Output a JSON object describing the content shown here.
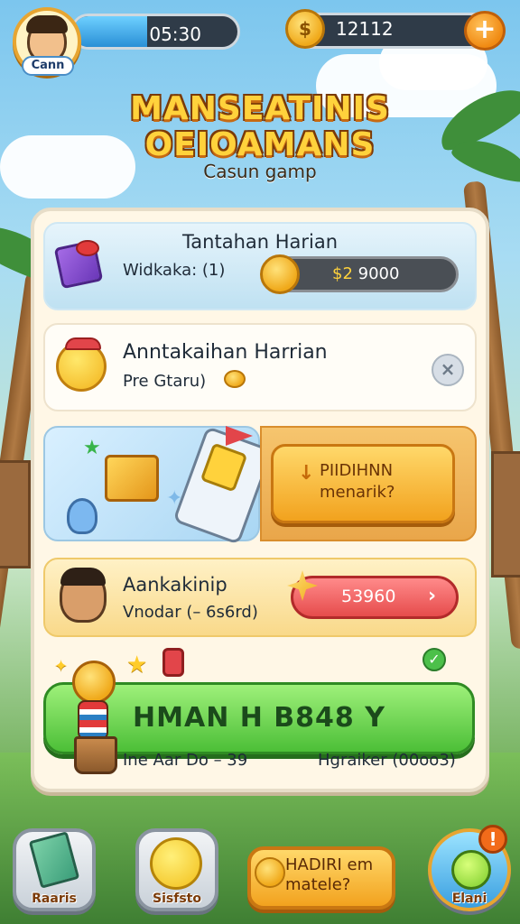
{
  "hud": {
    "player_name": "Cann",
    "timer": "05:30",
    "timer_progress": 0.45,
    "coins": "12112",
    "add_button": "+"
  },
  "title": {
    "line1": "MANSEATINIS",
    "line2": "OEIOAMANS",
    "subtitle": "Casun gamp"
  },
  "daily_card": {
    "heading": "Tantahan Harian",
    "label": "Widkaka: (1)",
    "currency": "$2",
    "amount": "9000"
  },
  "announcement_card": {
    "title": "Anntakaihan Harrian",
    "subtitle": "Pre Gtaru)",
    "close": "×"
  },
  "promo_card": {
    "button_icon": "↓",
    "button_text": "PIIDIHNN menarik?"
  },
  "reward_card": {
    "title": "Aankakinip",
    "subtitle": "Vnodar (– 6s6rd)",
    "value": "53960",
    "arrow": "›"
  },
  "main_action": {
    "label": "HMAN H B848 Y",
    "footer_left": "Ine Aar Do – 39",
    "footer_right": "Hgraiker (00oo3)",
    "check": "✓"
  },
  "nav": {
    "items": [
      {
        "label": "Raaris",
        "icon": "paintbrush-icon"
      },
      {
        "label": "Sisfsto",
        "icon": "sun-face-icon"
      },
      {
        "label": "HADIRI em matele?",
        "icon": "coin-icon"
      },
      {
        "label": "Elani",
        "icon": "smile-icon"
      }
    ],
    "badge": "!"
  },
  "colors": {
    "accent_gold": "#ffd23c",
    "accent_green": "#4cbf37",
    "accent_red": "#e64c4c",
    "accent_orange": "#f2a21e"
  }
}
